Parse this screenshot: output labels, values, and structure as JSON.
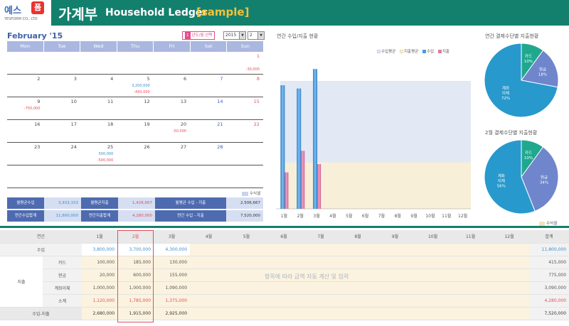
{
  "header": {
    "logo_text": "예스",
    "logo_badge": "폼",
    "logo_sub": "YESFORM CO., LTD",
    "title_kr": "가계부",
    "title_en": "Household Ledger",
    "title_sample": "[sample]"
  },
  "calendar": {
    "title": "February '15",
    "select_num": "1",
    "select_label": "년도/월 선택",
    "year": "2015",
    "month": "2",
    "days_header": [
      "Mon",
      "Tue",
      "Wed",
      "Thu",
      "Fri",
      "Sat",
      "Sun"
    ],
    "weeks": [
      [
        {
          "d": ""
        },
        {
          "d": ""
        },
        {
          "d": ""
        },
        {
          "d": ""
        },
        {
          "d": ""
        },
        {
          "d": ""
        },
        {
          "d": "1",
          "exp": "-30,000"
        }
      ],
      [
        {
          "d": "2"
        },
        {
          "d": "3"
        },
        {
          "d": "4"
        },
        {
          "d": "5",
          "inc": "3,200,000",
          "exp": "-493,000"
        },
        {
          "d": "6"
        },
        {
          "d": "7"
        },
        {
          "d": "8"
        }
      ],
      [
        {
          "d": "9",
          "exp": "-750,000"
        },
        {
          "d": "10"
        },
        {
          "d": "11"
        },
        {
          "d": "12"
        },
        {
          "d": "13"
        },
        {
          "d": "14"
        },
        {
          "d": "15"
        }
      ],
      [
        {
          "d": "16"
        },
        {
          "d": "17"
        },
        {
          "d": "18"
        },
        {
          "d": "19"
        },
        {
          "d": "20",
          "exp": "-50,000"
        },
        {
          "d": "21"
        },
        {
          "d": "22"
        }
      ],
      [
        {
          "d": "23"
        },
        {
          "d": "24"
        },
        {
          "d": "25",
          "inc": "500,000",
          "exp": "-500,000"
        },
        {
          "d": "26"
        },
        {
          "d": "27"
        },
        {
          "d": "28"
        },
        {
          "d": ""
        }
      ],
      [
        {
          "d": ""
        },
        {
          "d": ""
        },
        {
          "d": ""
        },
        {
          "d": ""
        },
        {
          "d": ""
        },
        {
          "d": ""
        },
        {
          "d": ""
        }
      ]
    ],
    "formula_legend": "수식셀"
  },
  "summary": {
    "monthly_avg_income_label": "월평균수입",
    "monthly_avg_income": "3,933,333",
    "monthly_avg_expense_label": "월평균지출",
    "monthly_avg_expense": "1,426,667",
    "monthly_avg_balance_label": "월평균 수입 - 지출",
    "monthly_avg_balance": "2,506,667",
    "annual_income_label": "연간수입합계",
    "annual_income": "11,800,000",
    "annual_expense_label": "연간지출합계",
    "annual_expense": "4,280,000",
    "annual_balance_label": "연간 수입 - 지출",
    "annual_balance": "7,520,000"
  },
  "annual_chart": {
    "title": "연간 수입/지출 현황",
    "legend": [
      "수입평균",
      "지출평균",
      "수입",
      "지출"
    ],
    "colors": {
      "income": "#4a9be0",
      "expense": "#e07aa8",
      "income_avg": "#e3e8f5",
      "expense_avg": "#f8efd8"
    }
  },
  "chart_data": [
    {
      "type": "bar",
      "title": "연간 수입/지출 현황",
      "categories": [
        "1월",
        "2월",
        "3월",
        "4월",
        "5월",
        "6월",
        "7월",
        "8월",
        "9월",
        "10월",
        "11월",
        "12월"
      ],
      "series": [
        {
          "name": "수입",
          "values": [
            3800000,
            3700000,
            4300000,
            0,
            0,
            0,
            0,
            0,
            0,
            0,
            0,
            0
          ]
        },
        {
          "name": "지출",
          "values": [
            1120000,
            1785000,
            1375000,
            0,
            0,
            0,
            0,
            0,
            0,
            0,
            0,
            0
          ]
        },
        {
          "name": "수입평균",
          "values": [
            3933333
          ]
        },
        {
          "name": "지출평균",
          "values": [
            1426667
          ]
        }
      ],
      "ylim": [
        0,
        4500000
      ]
    },
    {
      "type": "pie",
      "title": "연간 결제수단별 지출현황",
      "slices": [
        {
          "label": "카드",
          "value": 10,
          "pct": "10%"
        },
        {
          "label": "현금",
          "value": 18,
          "pct": "18%"
        },
        {
          "label": "계좌이체",
          "value": 72,
          "pct": "72%"
        }
      ]
    },
    {
      "type": "pie",
      "title": "2월 결제수단별 지출현황",
      "slices": [
        {
          "label": "카드",
          "value": 10,
          "pct": "10%"
        },
        {
          "label": "현금",
          "value": 34,
          "pct": "34%"
        },
        {
          "label": "계좌이체",
          "value": 56,
          "pct": "56%"
        }
      ]
    }
  ],
  "pie_colors": [
    "#20a88f",
    "#6f86cc",
    "#2899cc"
  ],
  "pie_legend": "수식셀",
  "table": {
    "header": [
      "연간",
      "1월",
      "2월",
      "3월",
      "4월",
      "5월",
      "6월",
      "7월",
      "8월",
      "9월",
      "10월",
      "11월",
      "12월",
      "합계"
    ],
    "income_label": "수입",
    "income": [
      "3,800,000",
      "3,700,000",
      "4,300,000",
      "",
      "",
      "",
      "",
      "",
      "",
      "",
      "",
      "",
      "11,800,000"
    ],
    "expense_label": "지출",
    "rows": [
      {
        "label": "카드",
        "values": [
          "100,000",
          "185,000",
          "130,000",
          "",
          "",
          "",
          "",
          "",
          "",
          "",
          "",
          "",
          "415,000"
        ]
      },
      {
        "label": "현금",
        "values": [
          "20,000",
          "600,000",
          "155,000",
          "",
          "",
          "",
          "",
          "",
          "",
          "",
          "",
          "",
          "775,000"
        ]
      },
      {
        "label": "계좌이체",
        "values": [
          "1,000,000",
          "1,000,000",
          "1,090,000",
          "",
          "",
          "",
          "",
          "",
          "",
          "",
          "",
          "",
          "3,090,000"
        ]
      },
      {
        "label": "소계",
        "values": [
          "1,120,000",
          "1,785,000",
          "1,375,000",
          "",
          "",
          "",
          "",
          "",
          "",
          "",
          "",
          "",
          "4,280,000"
        ]
      }
    ],
    "balance_label": "수입-지출",
    "balance": [
      "2,680,000",
      "1,915,000",
      "2,925,000",
      "",
      "",
      "",
      "",
      "",
      "",
      "",
      "",
      "",
      "7,520,000"
    ],
    "auto_note": "항목에 따라 금액 자동 계산 및 입력"
  }
}
